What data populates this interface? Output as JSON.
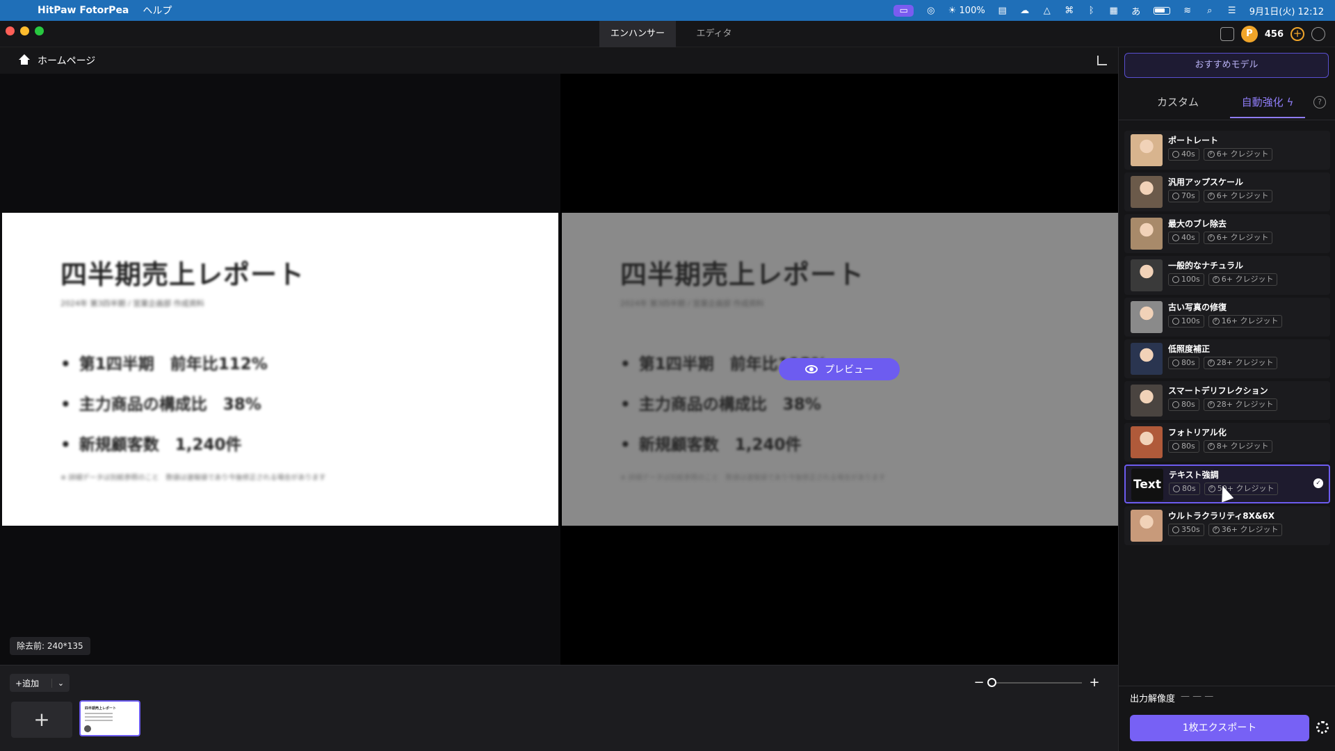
{
  "menubar": {
    "app_name": "HitPaw FotorPea",
    "menus": [
      "ヘルプ"
    ],
    "brightness": "100%",
    "clock": "9月1日(火) 12:12"
  },
  "titlebar": {
    "tabs": [
      {
        "label": "エンハンサー",
        "active": true
      },
      {
        "label": "エディタ",
        "active": false
      }
    ],
    "credits": "456"
  },
  "toolbar": {
    "home_label": "ホームページ"
  },
  "slide": {
    "title": "四半期売上レポート",
    "subtitle": "2024年 第3四半期 / 営業企画部 作成資料",
    "bullets": [
      "第1四半期　前年比112%",
      "主力商品の構成比　38%",
      "新規顧客数　1,240件"
    ],
    "footer": "※ 詳細データは別紙参照のこと　数値は速報値であり今後修正される場合があります"
  },
  "preview_label": "プレビュー",
  "size_badge": "除去前: 240*135",
  "bottom": {
    "add_label": "追加",
    "add_tile": "+",
    "thumb_title": "四半期売上レポート"
  },
  "sidebar": {
    "recommended": "おすすめモデル",
    "tab_custom": "カスタム",
    "tab_auto": "自動強化",
    "models": [
      {
        "name": "ポートレート",
        "time": "40s",
        "credits": "6+ クレジット",
        "thumb": "#d8b48e"
      },
      {
        "name": "汎用アップスケール",
        "time": "70s",
        "credits": "6+ クレジット",
        "thumb": "#6b5a4a"
      },
      {
        "name": "最大のブレ除去",
        "time": "40s",
        "credits": "6+ クレジット",
        "thumb": "#a88a6a"
      },
      {
        "name": "一般的なナチュラル",
        "time": "100s",
        "credits": "6+ クレジット",
        "thumb": "#3a3a3a"
      },
      {
        "name": "古い写真の修復",
        "time": "100s",
        "credits": "16+ クレジット",
        "thumb": "#8a8a8a"
      },
      {
        "name": "低照度補正",
        "time": "80s",
        "credits": "28+ クレジット",
        "thumb": "#2a3550"
      },
      {
        "name": "スマートデリフレクション",
        "time": "80s",
        "credits": "28+ クレジット",
        "thumb": "#4a4440"
      },
      {
        "name": "フォトリアル化",
        "time": "80s",
        "credits": "8+ クレジット",
        "thumb": "#b05a3a"
      },
      {
        "name": "テキスト強調",
        "time": "80s",
        "credits": "50+ クレジット",
        "thumb_text": "Text",
        "selected": true
      },
      {
        "name": "ウルトラクラリティ8X&6X",
        "time": "350s",
        "credits": "36+ クレジット",
        "thumb": "#c89a7a"
      }
    ],
    "output_label": "出力解像度",
    "output_value": "— — —",
    "export_label": "1枚エクスポート"
  }
}
